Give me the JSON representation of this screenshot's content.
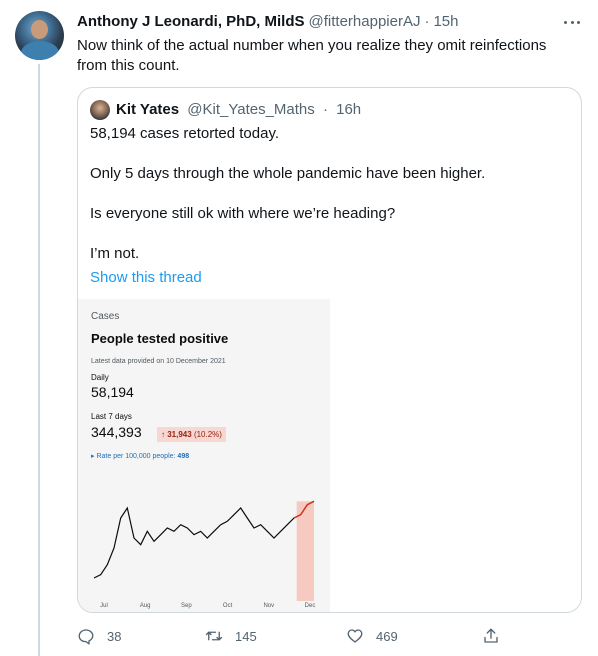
{
  "tweet": {
    "author_name": "Anthony J Leonardi, PhD, MildS",
    "handle": "@fitterhappierAJ",
    "separator": "·",
    "time": "15h",
    "text": "Now think of the actual number when you realize they omit reinfections from this count."
  },
  "quoted": {
    "author_name": "Kit Yates",
    "handle": "@Kit_Yates_Maths",
    "separator": "·",
    "time": "16h",
    "paragraphs": [
      "58,194 cases retorted today.",
      "Only 5 days through the whole pandemic have been higher.",
      "Is everyone still ok with where we’re heading?",
      "I’m not."
    ],
    "show_thread": "Show this thread",
    "media": {
      "section": "Cases",
      "title": "People tested positive",
      "latest": "Latest data provided on 10 December 2021",
      "daily_label": "Daily",
      "daily_value": "58,194",
      "week_label": "Last 7 days",
      "week_value": "344,393",
      "change_arrow": "↑",
      "change_value": "31,943",
      "change_pct": "(10.2%)",
      "rate_label": "▸ Rate per 100,000 people:",
      "rate_value": "498",
      "colors": {
        "line": "#0b0c0c",
        "highlight": "#f6c9c1",
        "highlight_line": "#d4351c"
      }
    }
  },
  "chart_data": {
    "type": "line",
    "categories": [
      "Jul",
      "Aug",
      "Sep",
      "Oct",
      "Nov",
      "Dec"
    ],
    "x": [
      "Jul 1",
      "Jul 6",
      "Jul 11",
      "Jul 16",
      "Jul 21",
      "Jul 26",
      "Jul 31",
      "Aug 5",
      "Aug 10",
      "Aug 15",
      "Aug 20",
      "Aug 25",
      "Aug 30",
      "Sep 4",
      "Sep 9",
      "Sep 14",
      "Sep 19",
      "Sep 24",
      "Sep 29",
      "Oct 4",
      "Oct 9",
      "Oct 14",
      "Oct 19",
      "Oct 24",
      "Oct 29",
      "Nov 3",
      "Nov 8",
      "Nov 13",
      "Nov 18",
      "Nov 23",
      "Nov 28",
      "Dec 3",
      "Dec 8",
      "Dec 10"
    ],
    "series": [
      {
        "values": [
          6,
          8,
          14,
          24,
          42,
          48,
          30,
          26,
          34,
          28,
          32,
          36,
          34,
          38,
          36,
          32,
          34,
          30,
          34,
          38,
          40,
          44,
          48,
          42,
          36,
          38,
          34,
          30,
          34,
          38,
          42,
          44,
          50,
          52
        ]
      }
    ],
    "highlight": {
      "from": "Dec 1",
      "to": "Dec 10",
      "label": "Last 7 days"
    },
    "ylim": [
      0,
      60
    ]
  },
  "actions": {
    "reply_count": "38",
    "retweet_count": "145",
    "like_count": "469"
  }
}
